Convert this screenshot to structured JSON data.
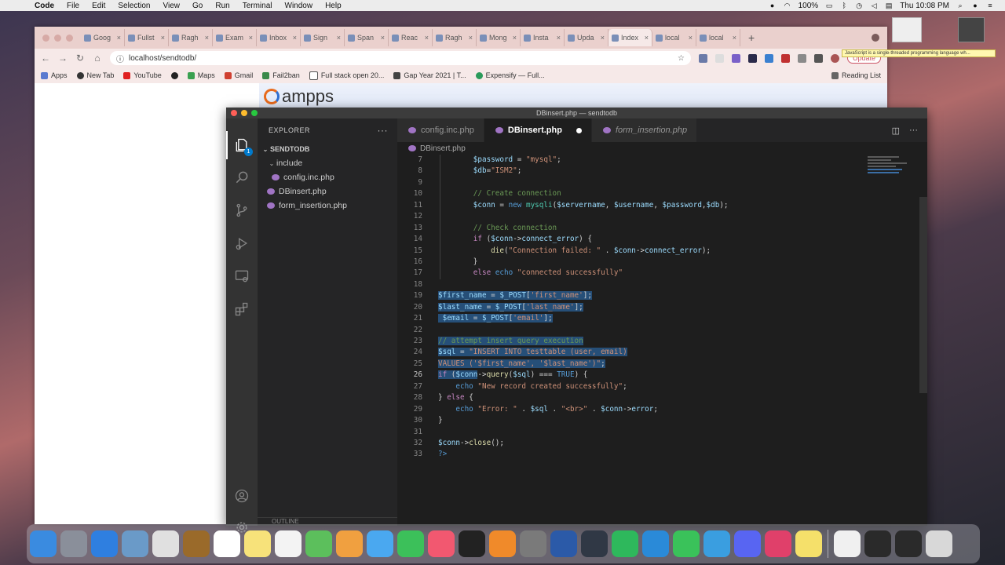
{
  "menubar": {
    "items": [
      "Code",
      "File",
      "Edit",
      "Selection",
      "View",
      "Go",
      "Run",
      "Terminal",
      "Window",
      "Help"
    ],
    "battery": "100%",
    "clock": "Thu 10:08 PM"
  },
  "chrome": {
    "tabs": [
      "Goog",
      "Fullst",
      "Ragh",
      "Exam",
      "Inbox",
      "Sign",
      "Span",
      "Reac",
      "Ragh",
      "Mong",
      "Insta",
      "Upda",
      "Index",
      "local",
      "local"
    ],
    "active_tab_index": 12,
    "url": "localhost/sendtodb/",
    "update_label": "Update",
    "bookmarks": [
      "Apps",
      "New Tab",
      "YouTube",
      "Maps",
      "Gmail",
      "Fail2ban",
      "Full stack open 20...",
      "Gap Year 2021 | T...",
      "Expensify — Full..."
    ],
    "reading_list": "Reading List",
    "tooltip": "JavaScript is a single-threaded programming language wh..."
  },
  "ampps": {
    "logo": "ampps"
  },
  "vscode": {
    "title": "DBinsert.php — sendtodb",
    "explorer_label": "EXPLORER",
    "explorer_badge": "1",
    "folder": "SENDTODB",
    "tree": [
      {
        "label": "include",
        "type": "folder"
      },
      {
        "label": "config.inc.php",
        "type": "file",
        "indent": 2
      },
      {
        "label": "DBinsert.php",
        "type": "file",
        "indent": 1
      },
      {
        "label": "form_insertion.php",
        "type": "file",
        "indent": 1
      }
    ],
    "outline_label": "OUTLINE",
    "tabs": [
      {
        "label": "config.inc.php"
      },
      {
        "label": "DBinsert.php"
      },
      {
        "label": "form_insertion.php"
      }
    ],
    "breadcrumb": "DBinsert.php",
    "current_line": 26
  },
  "code_lines": [
    {
      "n": "7",
      "html": "        <span class='v'>$password</span> = <span class='s'>\"mysql\"</span>;"
    },
    {
      "n": "8",
      "html": "        <span class='v'>$db</span>=<span class='s'>\"ISM2\"</span>;"
    },
    {
      "n": "9",
      "html": ""
    },
    {
      "n": "10",
      "html": "        <span class='cm'>// Create connection</span>"
    },
    {
      "n": "11",
      "html": "        <span class='v'>$conn</span> = <span class='k'>new</span> <span class='n'>mysqli</span>(<span class='v'>$servername</span>, <span class='v'>$username</span>, <span class='v'>$password</span>,<span class='v'>$db</span>);"
    },
    {
      "n": "12",
      "html": ""
    },
    {
      "n": "13",
      "html": "        <span class='cm'>// Check connection</span>"
    },
    {
      "n": "14",
      "html": "        <span class='c'>if</span> (<span class='v'>$conn</span>-&gt;<span class='v'>connect_error</span>) {"
    },
    {
      "n": "15",
      "html": "            <span class='f'>die</span>(<span class='s'>\"Connection failed: \"</span> . <span class='v'>$conn</span>-&gt;<span class='v'>connect_error</span>);"
    },
    {
      "n": "16",
      "html": "        }"
    },
    {
      "n": "17",
      "html": "        <span class='c'>else</span> <span class='k'>echo</span> <span class='s'>\"connected successfully\"</span>"
    },
    {
      "n": "18",
      "html": ""
    },
    {
      "n": "19",
      "html": "<span class='sel'><span class='v'>$first_name</span> = <span class='v'>$_POST</span>[<span class='s'>'first_name'</span>];</span>"
    },
    {
      "n": "20",
      "html": "<span class='sel'><span class='v'>$last_name</span> = <span class='v'>$_POST</span>[<span class='s'>'last_name'</span>];</span>"
    },
    {
      "n": "21",
      "html": "<span class='sel'> <span class='v'>$email</span> = <span class='v'>$_POST</span>[<span class='s'>'email'</span>];</span>"
    },
    {
      "n": "22",
      "html": ""
    },
    {
      "n": "23",
      "html": "<span class='sel'><span class='cm'>// attempt insert query execution</span></span>"
    },
    {
      "n": "24",
      "html": "<span class='sel'><span class='v'>$sql</span> = <span class='s'>\"INSERT INTO testtable (user, email)</span></span>"
    },
    {
      "n": "25",
      "html": "<span class='sel'><span class='s'>VALUES ('$first_name', '$last_name')\"</span>;</span>"
    },
    {
      "n": "26",
      "html": "<span class='sel'><span class='c'>if</span> (<span class='v'>$conn</span></span>-&gt;<span class='f'>query</span>(<span class='v'>$sql</span>) === <span class='k'>TRUE</span>) {"
    },
    {
      "n": "27",
      "html": "    <span class='k'>echo</span> <span class='s'>\"New record created successfully\"</span>;"
    },
    {
      "n": "28",
      "html": "} <span class='c'>else</span> {"
    },
    {
      "n": "29",
      "html": "    <span class='k'>echo</span> <span class='s'>\"Error: \"</span> . <span class='v'>$sql</span> . <span class='s'>\"&lt;br&gt;\"</span> . <span class='v'>$conn</span>-&gt;<span class='v'>error</span>;"
    },
    {
      "n": "30",
      "html": "}"
    },
    {
      "n": "31",
      "html": ""
    },
    {
      "n": "32",
      "html": "<span class='v'>$conn</span>-&gt;<span class='f'>close</span>();"
    },
    {
      "n": "33",
      "html": "<span class='k'>?&gt;</span>"
    }
  ],
  "dock": {
    "apps": [
      {
        "name": "finder-icon",
        "color": "#3a8be0"
      },
      {
        "name": "launchpad-icon",
        "color": "#8a8f9a"
      },
      {
        "name": "safari-icon",
        "color": "#2f7fe0"
      },
      {
        "name": "preview-icon",
        "color": "#6a9ac8"
      },
      {
        "name": "chrome-icon",
        "color": "#e0e0e0"
      },
      {
        "name": "notes-folder-icon",
        "color": "#9a6a2a"
      },
      {
        "name": "calendar-icon",
        "color": "#ffffff"
      },
      {
        "name": "notes-icon",
        "color": "#f7e27a"
      },
      {
        "name": "reminders-icon",
        "color": "#f3f3f3"
      },
      {
        "name": "maps-icon",
        "color": "#5cbf5c"
      },
      {
        "name": "photos-icon",
        "color": "#f0a040"
      },
      {
        "name": "messages-icon",
        "color": "#4aa8f0"
      },
      {
        "name": "facetime-icon",
        "color": "#3cc05a"
      },
      {
        "name": "music-icon",
        "color": "#f25870"
      },
      {
        "name": "terminal-icon",
        "color": "#222222"
      },
      {
        "name": "books-icon",
        "color": "#f08a2a"
      },
      {
        "name": "system-preferences-icon",
        "color": "#7a7a7a"
      },
      {
        "name": "word-icon",
        "color": "#2b5aa8"
      },
      {
        "name": "quicktime-icon",
        "color": "#303845"
      },
      {
        "name": "evernote-icon",
        "color": "#2eb85c"
      },
      {
        "name": "vscode-icon",
        "color": "#2a8ad8"
      },
      {
        "name": "whatsapp-icon",
        "color": "#3ac25a"
      },
      {
        "name": "telegram-icon",
        "color": "#3a9ee0"
      },
      {
        "name": "discord-icon",
        "color": "#5865f2"
      },
      {
        "name": "intellij-icon",
        "color": "#e0406a"
      },
      {
        "name": "stickies-icon",
        "color": "#f5e06a"
      }
    ],
    "right": [
      {
        "name": "document-icon",
        "color": "#f0f0f0"
      },
      {
        "name": "terminal-window-icon",
        "color": "#2a2a2a"
      },
      {
        "name": "vscode-window-icon",
        "color": "#2a2a2a"
      },
      {
        "name": "trash-icon",
        "color": "#d8d8d8"
      }
    ]
  }
}
